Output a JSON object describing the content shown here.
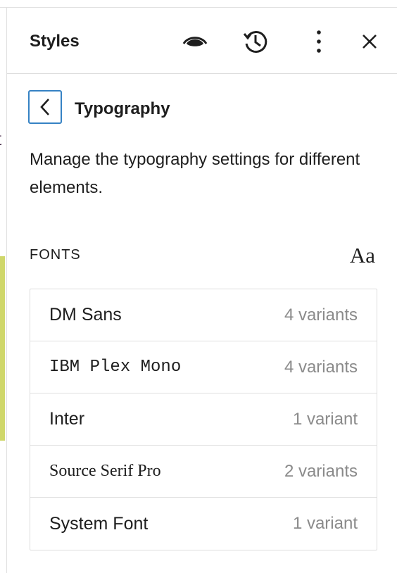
{
  "editor": {
    "stray_letter": "t"
  },
  "header": {
    "title": "Styles",
    "icons": [
      "eye-icon",
      "history-icon",
      "more-vertical-icon",
      "close-icon"
    ]
  },
  "navigator": {
    "back_icon": "chevron-left-icon",
    "title": "Typography"
  },
  "description": "Manage the typography settings for different elements.",
  "fonts": {
    "label": "FONTS",
    "add_icon_text": "Aa",
    "items": [
      {
        "name": "DM Sans",
        "variants": "4 variants"
      },
      {
        "name": "IBM Plex Mono",
        "variants": "4 variants"
      },
      {
        "name": "Inter",
        "variants": "1 variant"
      },
      {
        "name": "Source Serif Pro",
        "variants": "2 variants"
      },
      {
        "name": "System Font",
        "variants": "1 variant"
      }
    ]
  },
  "colors": {
    "focus_border": "#3582c4",
    "muted_text": "#8a8a8a",
    "accent_bar": "#cfd76a"
  }
}
